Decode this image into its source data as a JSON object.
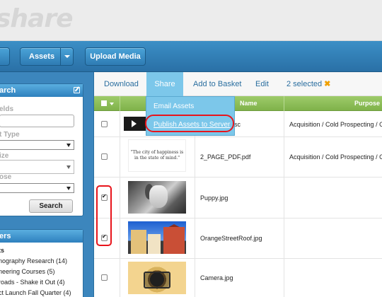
{
  "app": {
    "logo_text": "share"
  },
  "navbar": {
    "assets_label": "Assets",
    "upload_label": "Upload Media"
  },
  "sidebar": {
    "search": {
      "title": "arch",
      "fields_label": "elds",
      "asset_type_label": "t Type",
      "size_label": "ize",
      "purpose_label": "ose",
      "search_button": "Search"
    },
    "folders": {
      "title": "ers",
      "root": "ts",
      "items": [
        "nography Research (14)",
        "neering Courses (5)",
        "roads - Shake it Out (4)",
        "ct Launch Fall Quarter (4)"
      ]
    }
  },
  "toolbar": {
    "tabs": [
      "Download",
      "Share",
      "Add to Basket",
      "Edit"
    ],
    "selected_text": "2 selected"
  },
  "share_menu": {
    "items": [
      "Email Assets",
      "Publish Assets to Server"
    ]
  },
  "grid": {
    "headers": [
      "T",
      "Name",
      "Purpose"
    ],
    "rows": [
      {
        "name": "sc",
        "purpose": "Acquisition / Cold Prospecting / Out",
        "checked": false,
        "thumb": "video"
      },
      {
        "name": "2_PAGE_PDF.pdf",
        "purpose": "Acquisition / Cold Prospecting / Out",
        "checked": false,
        "thumb": "quote",
        "thumb_text": "\"The city of happiness is in the state of mind.\""
      },
      {
        "name": "Puppy.jpg",
        "purpose": "",
        "checked": true,
        "thumb": "puppy"
      },
      {
        "name": "OrangeStreetRoof.jpg",
        "purpose": "",
        "checked": true,
        "thumb": "street"
      },
      {
        "name": "Camera.jpg",
        "purpose": "",
        "checked": false,
        "thumb": "camera"
      }
    ]
  },
  "colors": {
    "accent": "#2a70a6",
    "share_tab": "#7cc7ea",
    "grid_header": "#8cbf56",
    "annotation": "#e8141b"
  }
}
